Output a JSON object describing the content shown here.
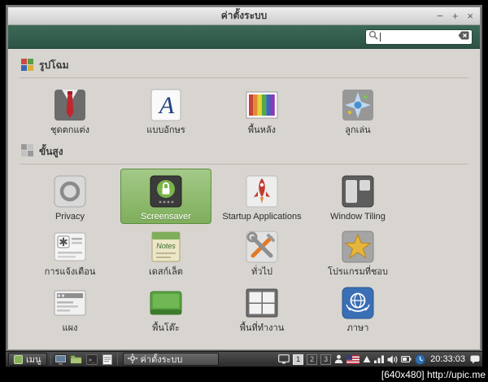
{
  "window": {
    "title": "ค่าตั้งระบบ",
    "controls": {
      "minimize": "−",
      "maximize": "+",
      "close": "×"
    },
    "search": {
      "value": ""
    }
  },
  "sections": [
    {
      "label": "รูปโฉม",
      "icon": "appearance-section-icon",
      "items": [
        {
          "label": "ชุดตกแต่ง",
          "icon": "themes-icon"
        },
        {
          "label": "แบบอักษร",
          "icon": "fonts-icon"
        },
        {
          "label": "พื้นหลัง",
          "icon": "backgrounds-icon"
        },
        {
          "label": "ลูกเล่น",
          "icon": "effects-icon"
        }
      ]
    },
    {
      "label": "ขั้นสูง",
      "icon": "advanced-section-icon",
      "items": [
        {
          "label": "Privacy",
          "icon": "privacy-icon"
        },
        {
          "label": "Screensaver",
          "icon": "screensaver-icon",
          "selected": true
        },
        {
          "label": "Startup Applications",
          "icon": "startup-applications-icon"
        },
        {
          "label": "Window Tiling",
          "icon": "window-tiling-icon"
        },
        {
          "label": "การแจ้งเตือน",
          "icon": "notifications-icon"
        },
        {
          "label": "เดสก์เล็ต",
          "icon": "desklets-icon"
        },
        {
          "label": "ทั่วไป",
          "icon": "general-icon"
        },
        {
          "label": "โปรแกรมที่ชอบ",
          "icon": "preferred-applications-icon"
        },
        {
          "label": "แผง",
          "icon": "panel-icon"
        },
        {
          "label": "พื้นโต๊ะ",
          "icon": "desktop-icon"
        },
        {
          "label": "พื้นที่ทำงาน",
          "icon": "workspaces-icon"
        },
        {
          "label": "ภาษา",
          "icon": "languages-icon"
        }
      ]
    }
  ],
  "taskbar": {
    "menu_label": "เมนู",
    "quick_launch_icons": [
      "show-desktop-icon",
      "file-manager-icon",
      "terminal-icon",
      "text-editor-icon"
    ],
    "window_button": {
      "label": "ค่าตั้งระบบ",
      "icon": "settings-gear-icon"
    },
    "tray": {
      "workspaces": [
        "1",
        "2",
        "3"
      ],
      "active_workspace": "1",
      "icons": [
        "display-icon",
        "user-icon",
        "flag-us-icon",
        "updates-icon",
        "network-icon",
        "volume-icon",
        "battery-icon",
        "clock-icon",
        "notifications-tray-icon"
      ],
      "time": "20:33:03"
    }
  },
  "watermark": "[640x480] http://upic.me",
  "colors": {
    "toolbar_green": "#35604e",
    "selection_green": "#8fb96d",
    "taskbar_dark": "#3a3a3a",
    "content_bg": "#d8d5d0"
  }
}
